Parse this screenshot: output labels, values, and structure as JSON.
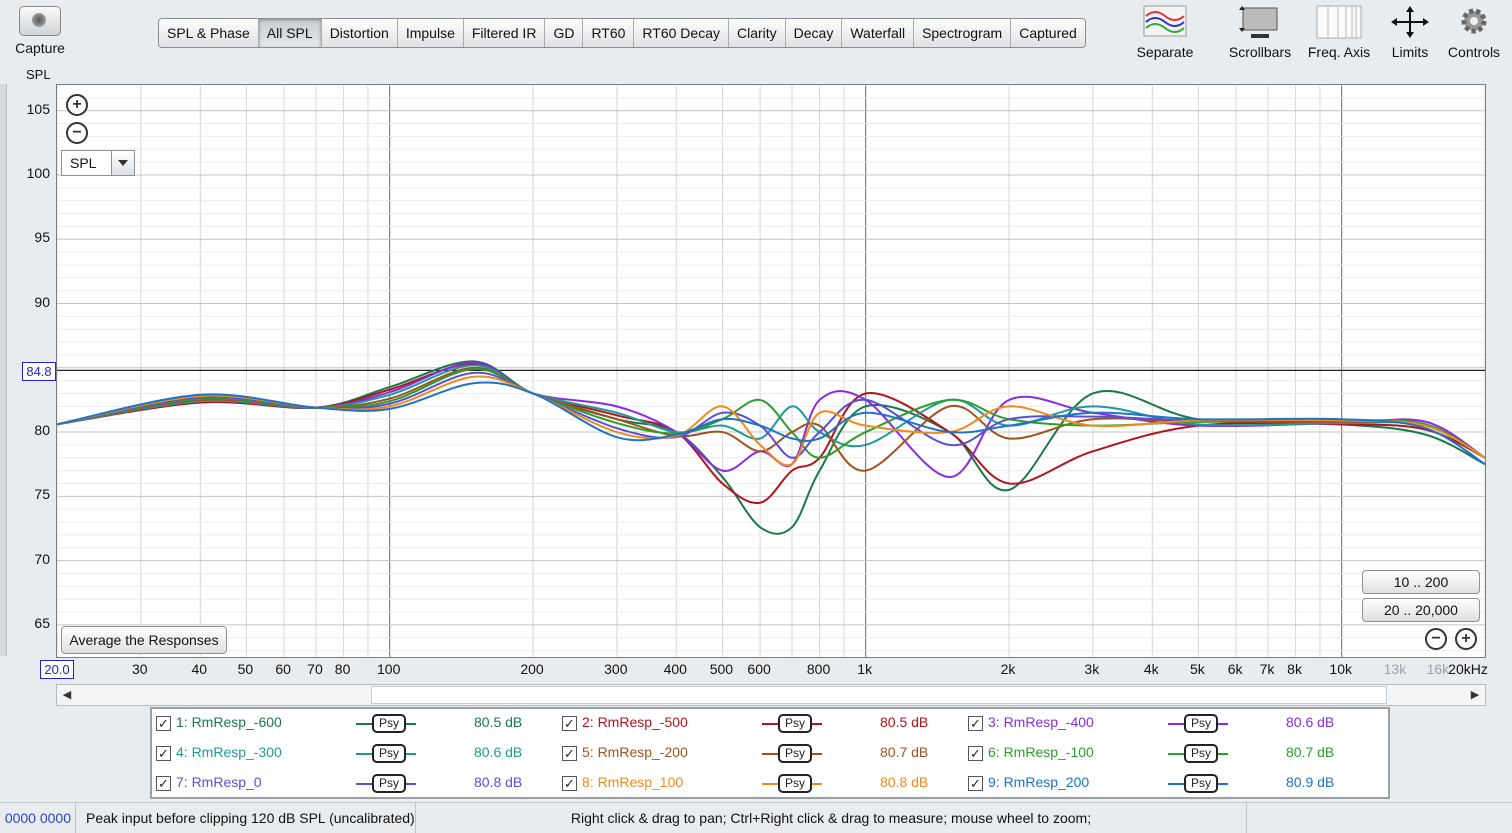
{
  "toolbar": {
    "capture_label": "Capture",
    "tabs": [
      "SPL & Phase",
      "All SPL",
      "Distortion",
      "Impulse",
      "Filtered IR",
      "GD",
      "RT60",
      "RT60 Decay",
      "Clarity",
      "Decay",
      "Waterfall",
      "Spectrogram",
      "Captured"
    ],
    "active_tab": "All SPL",
    "tools": [
      {
        "label": "Separate",
        "icon": "separate-icon"
      },
      {
        "label": "Scrollbars",
        "icon": "scrollbars-icon"
      },
      {
        "label": "Freq. Axis",
        "icon": "freq-axis-icon"
      },
      {
        "label": "Limits",
        "icon": "limits-icon"
      },
      {
        "label": "Controls",
        "icon": "gear-icon"
      }
    ]
  },
  "plot": {
    "y_title": "SPL",
    "y_readout": "84.8",
    "x_readout": "20.0",
    "view_selector": "SPL",
    "average_button": "Average the Responses",
    "range_buttons": [
      "10 .. 200",
      "20 .. 20,000"
    ],
    "y_ticks": [
      "105",
      "100",
      "95",
      "90",
      "80",
      "75",
      "70",
      "65"
    ],
    "x_ticks": [
      {
        "t": "30",
        "f": 30
      },
      {
        "t": "40",
        "f": 40
      },
      {
        "t": "50",
        "f": 50
      },
      {
        "t": "60",
        "f": 60
      },
      {
        "t": "70",
        "f": 70
      },
      {
        "t": "80",
        "f": 80
      },
      {
        "t": "100",
        "f": 100
      },
      {
        "t": "200",
        "f": 200
      },
      {
        "t": "300",
        "f": 300
      },
      {
        "t": "400",
        "f": 400
      },
      {
        "t": "500",
        "f": 500
      },
      {
        "t": "600",
        "f": 600
      },
      {
        "t": "800",
        "f": 800
      },
      {
        "t": "1k",
        "f": 1000
      },
      {
        "t": "2k",
        "f": 2000
      },
      {
        "t": "3k",
        "f": 3000
      },
      {
        "t": "4k",
        "f": 4000
      },
      {
        "t": "5k",
        "f": 5000
      },
      {
        "t": "6k",
        "f": 6000
      },
      {
        "t": "7k",
        "f": 7000
      },
      {
        "t": "8k",
        "f": 8000
      },
      {
        "t": "10k",
        "f": 10000
      },
      {
        "t": "13k",
        "f": 13000,
        "grey": true
      },
      {
        "t": "16k",
        "f": 16000,
        "grey": true
      },
      {
        "t": "20kHz",
        "f": 20000
      }
    ]
  },
  "legend": [
    {
      "label": "1: RmResp_-600",
      "db": "80.5 dB",
      "color": "#1a7a47"
    },
    {
      "label": "2: RmResp_-500",
      "db": "80.5 dB",
      "color": "#b3131b"
    },
    {
      "label": "3: RmResp_-400",
      "db": "80.6 dB",
      "color": "#8a2be2"
    },
    {
      "label": "4: RmResp_-300",
      "db": "80.6 dB",
      "color": "#1f9a9a"
    },
    {
      "label": "5: RmResp_-200",
      "db": "80.7 dB",
      "color": "#a0521e"
    },
    {
      "label": "6: RmResp_-100",
      "db": "80.7 dB",
      "color": "#2aa02a"
    },
    {
      "label": "7: RmResp_0",
      "db": "80.8 dB",
      "color": "#5b4fd6"
    },
    {
      "label": "8: RmResp_100",
      "db": "80.8 dB",
      "color": "#f08a1c"
    },
    {
      "label": "9: RmResp_200",
      "db": "80.9 dB",
      "color": "#1e73c8"
    }
  ],
  "psy_label": "Psy",
  "status": {
    "left": "0000 0000",
    "peak": "Peak input before clipping 120 dB SPL (uncalibrated)",
    "hint": "Right click & drag to pan; Ctrl+Right click & drag to measure; mouse wheel to zoom;"
  },
  "chart_data": {
    "type": "line",
    "xlabel": "",
    "ylabel": "SPL",
    "xscale": "log",
    "xlim": [
      20,
      20000
    ],
    "ylim": [
      62.5,
      107
    ],
    "grid": true,
    "reference_line": 84.8,
    "series": [
      {
        "name": "1: RmResp_-600",
        "color": "#1a7a47",
        "x": [
          20,
          40,
          70,
          100,
          150,
          200,
          300,
          400,
          500,
          600,
          700,
          800,
          1000,
          1500,
          2000,
          3000,
          5000,
          10000,
          15000,
          20000
        ],
        "y": [
          80.6,
          82.3,
          81.9,
          83.5,
          85.5,
          83.0,
          81.0,
          80.0,
          76.5,
          72.6,
          72.6,
          77.0,
          82.0,
          80.0,
          75.5,
          83.0,
          81.0,
          80.6,
          79.8,
          77.5
        ]
      },
      {
        "name": "2: RmResp_-500",
        "color": "#b3131b",
        "x": [
          20,
          40,
          70,
          100,
          150,
          200,
          300,
          400,
          500,
          600,
          700,
          800,
          1000,
          1500,
          2000,
          3000,
          5000,
          10000,
          15000,
          20000
        ],
        "y": [
          80.6,
          82.3,
          81.9,
          83.3,
          85.3,
          83.0,
          81.3,
          80.0,
          76.0,
          74.5,
          77.0,
          78.0,
          83.0,
          80.0,
          76.0,
          78.5,
          80.5,
          80.6,
          80.2,
          78.0
        ]
      },
      {
        "name": "3: RmResp_-400",
        "color": "#8a2be2",
        "x": [
          20,
          40,
          70,
          100,
          150,
          200,
          300,
          400,
          500,
          600,
          700,
          800,
          1000,
          1500,
          2000,
          3000,
          5000,
          10000,
          15000,
          20000
        ],
        "y": [
          80.6,
          82.4,
          81.9,
          83.1,
          85.4,
          83.0,
          82.0,
          80.0,
          77.0,
          78.5,
          77.5,
          82.5,
          82.5,
          76.5,
          82.5,
          81.5,
          80.5,
          80.7,
          80.8,
          78.0
        ]
      },
      {
        "name": "4: RmResp_-300",
        "color": "#1f9a9a",
        "x": [
          20,
          40,
          70,
          100,
          150,
          200,
          300,
          400,
          500,
          600,
          700,
          800,
          1000,
          1500,
          2000,
          3000,
          5000,
          10000,
          15000,
          20000
        ],
        "y": [
          80.6,
          82.4,
          81.9,
          82.9,
          85.2,
          83.0,
          81.5,
          80.0,
          80.5,
          79.5,
          82.0,
          80.0,
          79.0,
          82.5,
          80.5,
          82.0,
          80.6,
          80.7,
          80.5,
          78.0
        ]
      },
      {
        "name": "5: RmResp_-200",
        "color": "#a0521e",
        "x": [
          20,
          40,
          70,
          100,
          150,
          200,
          300,
          400,
          500,
          600,
          700,
          800,
          1000,
          1500,
          2000,
          3000,
          5000,
          10000,
          15000,
          20000
        ],
        "y": [
          80.6,
          82.5,
          81.9,
          82.6,
          85.0,
          83.0,
          81.0,
          79.7,
          80.0,
          78.5,
          80.0,
          80.5,
          77.0,
          82.0,
          79.5,
          81.0,
          80.8,
          80.8,
          80.6,
          78.0
        ]
      },
      {
        "name": "6: RmResp_-100",
        "color": "#2aa02a",
        "x": [
          20,
          40,
          70,
          100,
          150,
          200,
          300,
          400,
          500,
          600,
          700,
          800,
          1000,
          1500,
          2000,
          3000,
          5000,
          10000,
          15000,
          20000
        ],
        "y": [
          80.6,
          82.6,
          81.9,
          82.4,
          84.9,
          83.0,
          80.7,
          79.9,
          81.0,
          82.5,
          80.0,
          78.0,
          80.0,
          82.5,
          81.0,
          80.5,
          80.8,
          80.9,
          80.6,
          78.0
        ]
      },
      {
        "name": "7: RmResp_0",
        "color": "#5b4fd6",
        "x": [
          20,
          40,
          70,
          100,
          150,
          200,
          300,
          400,
          500,
          600,
          700,
          800,
          1000,
          1500,
          2000,
          3000,
          5000,
          10000,
          15000,
          20000
        ],
        "y": [
          80.6,
          82.7,
          81.9,
          82.2,
          84.6,
          83.0,
          80.3,
          79.6,
          81.5,
          80.5,
          78.0,
          80.0,
          82.5,
          79.0,
          81.0,
          81.2,
          80.9,
          80.9,
          80.5,
          78.0
        ]
      },
      {
        "name": "8: RmResp_100",
        "color": "#f08a1c",
        "x": [
          20,
          40,
          70,
          100,
          150,
          200,
          300,
          400,
          500,
          600,
          700,
          800,
          1000,
          1500,
          2000,
          3000,
          5000,
          10000,
          15000,
          20000
        ],
        "y": [
          80.6,
          82.8,
          81.9,
          82.0,
          84.3,
          83.0,
          80.0,
          79.7,
          82.0,
          79.0,
          77.5,
          81.5,
          80.5,
          80.0,
          82.0,
          80.5,
          80.9,
          80.9,
          80.5,
          78.0
        ]
      },
      {
        "name": "9: RmResp_200",
        "color": "#1e73c8",
        "x": [
          20,
          40,
          70,
          100,
          150,
          200,
          300,
          400,
          500,
          600,
          700,
          800,
          1000,
          1500,
          2000,
          3000,
          5000,
          10000,
          15000,
          20000
        ],
        "y": [
          80.6,
          82.9,
          81.9,
          81.8,
          83.8,
          83.0,
          79.6,
          79.8,
          81.0,
          80.5,
          79.5,
          79.5,
          81.5,
          80.0,
          80.5,
          81.5,
          81.0,
          81.0,
          80.3,
          77.5
        ]
      }
    ]
  }
}
